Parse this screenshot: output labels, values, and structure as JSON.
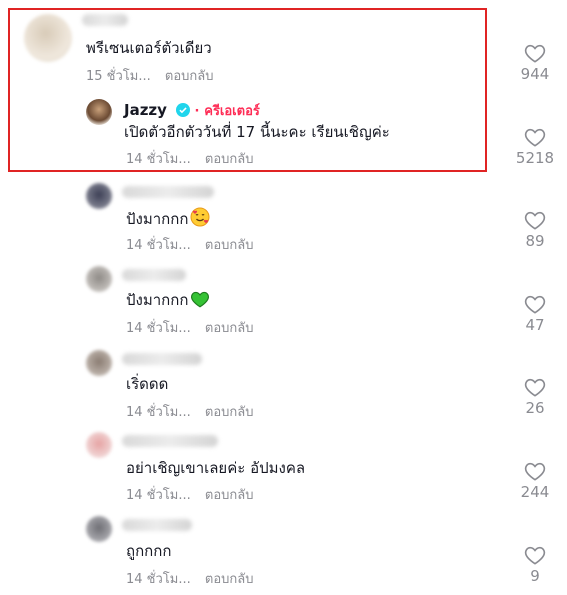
{
  "comments": [
    {
      "text": "พรีเซนเตอร์ตัวเดียว",
      "time": "15 ชั่วโม...",
      "reply_label": "ตอบกลับ",
      "likes": "944"
    },
    {
      "username": "Jazzy",
      "badge": "ครีเอเตอร์",
      "badge_separator": "·",
      "text": "เปิดตัวอีกตัววันที่ 17 นี้นะคะ เรียนเชิญค่ะ",
      "time": "14 ชั่วโม...",
      "reply_label": "ตอบกลับ",
      "likes": "5218"
    },
    {
      "text": "ปังมากกก",
      "emoji": "smiling-face-with-hearts",
      "time": "14 ชั่วโม...",
      "reply_label": "ตอบกลับ",
      "likes": "89"
    },
    {
      "text": "ปังมากกก",
      "emoji": "green-heart",
      "time": "14 ชั่วโม...",
      "reply_label": "ตอบกลับ",
      "likes": "47"
    },
    {
      "text": "เริ่ดดด",
      "time": "14 ชั่วโม...",
      "reply_label": "ตอบกลับ",
      "likes": "26"
    },
    {
      "text": "อย่าเชิญเขาเลยค่ะ อัปมงคล",
      "time": "14 ชั่วโม...",
      "reply_label": "ตอบกลับ",
      "likes": "244"
    },
    {
      "text": "ถูกกกก",
      "time": "14 ชั่วโม...",
      "reply_label": "ตอบกลับ",
      "likes": "9"
    }
  ],
  "colors": {
    "highlight_border": "#e02424",
    "creator_badge": "#fe2c55",
    "verified": "#20d5ec",
    "meta_text": "#8a8b91"
  }
}
